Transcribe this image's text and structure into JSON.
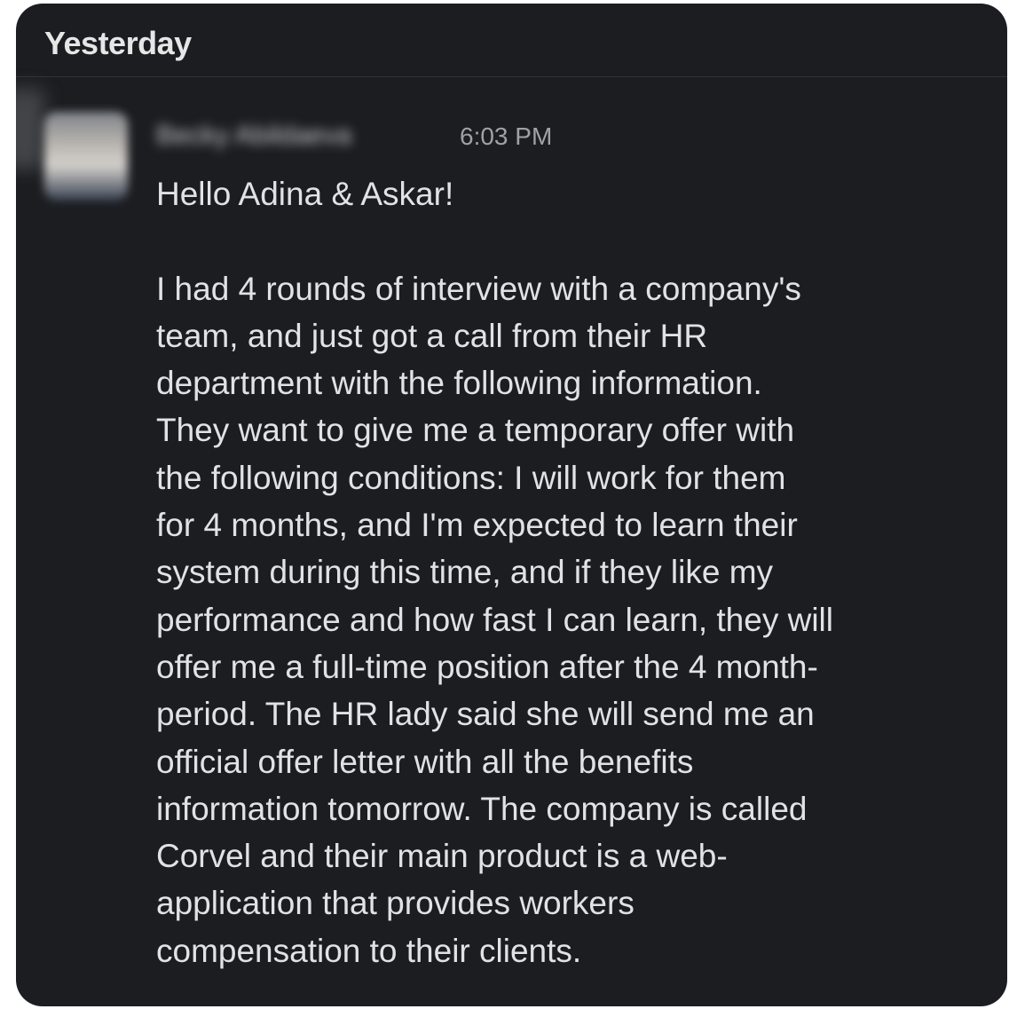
{
  "conversation": {
    "day_header": "Yesterday",
    "message": {
      "sender_name": "Becky Abildaeva",
      "timestamp": "6:03 PM",
      "greeting": "Hello Adina & Askar!",
      "body_lines": [
        "I had 4 rounds of interview with a company's",
        "team, and just got a call from their HR",
        "department with the following information.",
        "They want to give me a temporary offer with",
        "the following conditions: I will work for them",
        "for 4 months, and I'm expected to learn their",
        "system during this time, and if they like my",
        "performance and how fast I can learn, they will",
        "offer me a full-time position after the 4 month-",
        "period. The HR lady said she will send me an",
        "official offer letter with all the benefits",
        "information tomorrow. The company is called",
        "Corvel and their main product is a web-",
        "application that provides workers",
        "compensation to their clients."
      ]
    }
  }
}
